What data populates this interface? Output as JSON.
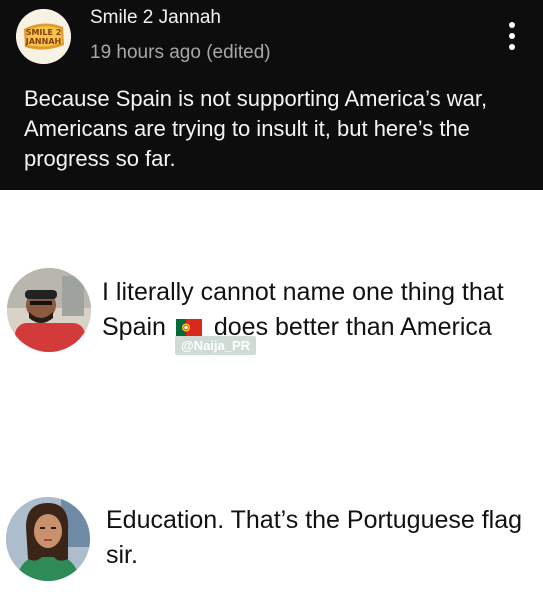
{
  "post": {
    "channel_name": "Smile 2 Jannah",
    "time": "19 hours ago (edited)",
    "text": "Because Spain is not supporting America’s war, Americans are trying to insult it, but here’s the progress so far.",
    "logo_text": "SMILE 2 JANNAH",
    "menu_icon": "kebab-menu-icon"
  },
  "replies": [
    {
      "text_before_flag": "I literally cannot name one thing that Spain",
      "flag": "portugal-flag-emoji",
      "text_after_flag": "does better than America",
      "watermark": "@Naija_PR"
    },
    {
      "text": "Education. That’s the Portuguese flag sir."
    }
  ],
  "colors": {
    "header_bg": "#0d0d0d",
    "portugal_green": "#046a38",
    "portugal_red": "#da291c"
  }
}
